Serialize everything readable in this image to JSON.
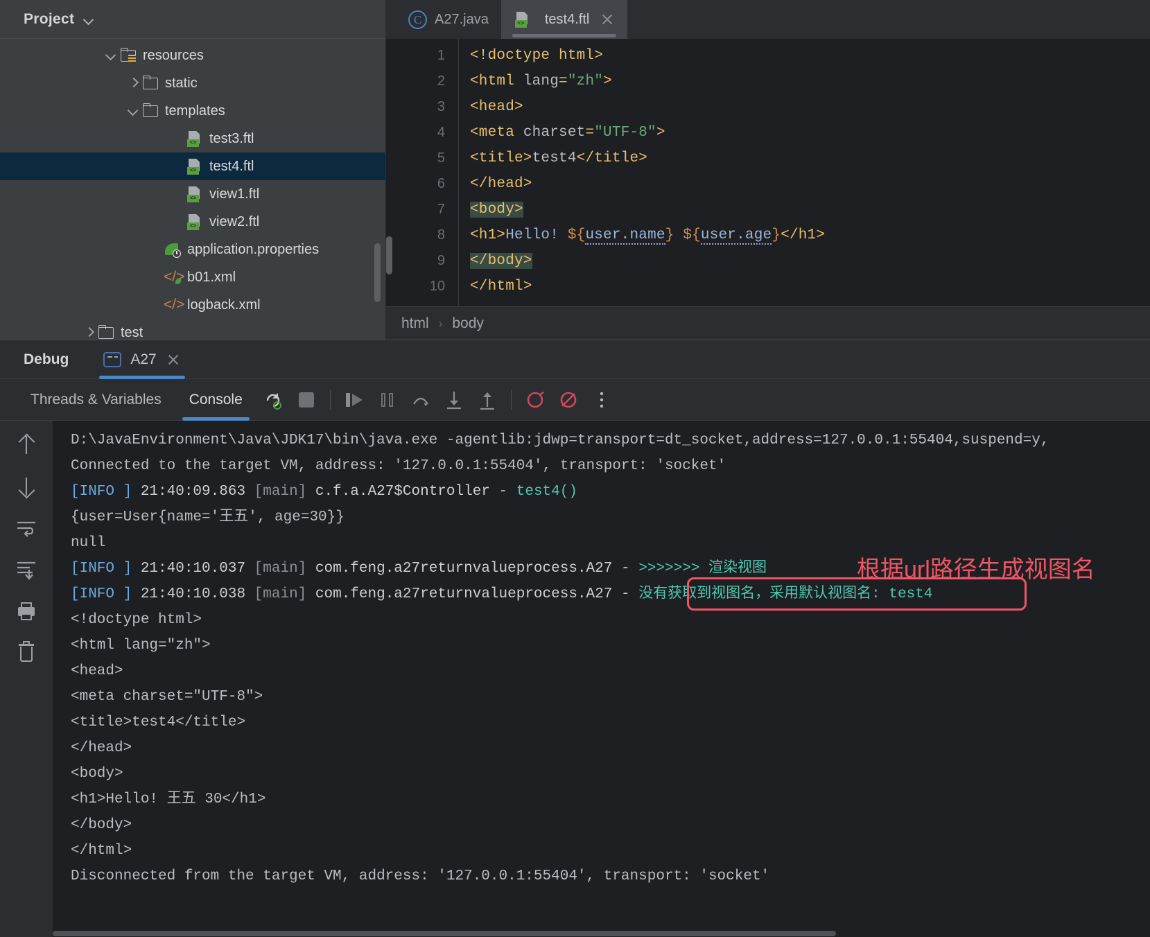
{
  "project": {
    "title": "Project",
    "toggle_icon": "chevron-down-icon",
    "tree": [
      {
        "label": "resources",
        "icon": "folder-resources-icon",
        "arrow": "down",
        "indent": 150,
        "selected": false
      },
      {
        "label": "static",
        "icon": "folder-icon",
        "arrow": "right",
        "indent": 182,
        "selected": false
      },
      {
        "label": "templates",
        "icon": "folder-icon",
        "arrow": "down",
        "indent": 182,
        "selected": false
      },
      {
        "label": "test3.ftl",
        "icon": "ftl-file-icon",
        "arrow": "none",
        "indent": 246,
        "selected": false
      },
      {
        "label": "test4.ftl",
        "icon": "ftl-file-icon",
        "arrow": "none",
        "indent": 246,
        "selected": true
      },
      {
        "label": "view1.ftl",
        "icon": "ftl-file-icon",
        "arrow": "none",
        "indent": 246,
        "selected": false
      },
      {
        "label": "view2.ftl",
        "icon": "ftl-file-icon",
        "arrow": "none",
        "indent": 246,
        "selected": false
      },
      {
        "label": "application.properties",
        "icon": "spring-properties-icon",
        "arrow": "none",
        "indent": 214,
        "selected": false
      },
      {
        "label": "b01.xml",
        "icon": "spring-xml-icon",
        "arrow": "none",
        "indent": 214,
        "selected": false
      },
      {
        "label": "logback.xml",
        "icon": "xml-icon",
        "arrow": "none",
        "indent": 214,
        "selected": false
      },
      {
        "label": "test",
        "icon": "folder-icon",
        "arrow": "right",
        "indent": 118,
        "selected": false
      }
    ]
  },
  "editor": {
    "tabs": [
      {
        "label": "A27.java",
        "icon": "java-class-icon",
        "active": false,
        "closable": false
      },
      {
        "label": "test4.ftl",
        "icon": "ftl-file-icon",
        "active": true,
        "closable": true
      }
    ],
    "line_numbers": [
      "1",
      "2",
      "3",
      "4",
      "5",
      "6",
      "7",
      "8",
      "9",
      "10"
    ],
    "code_lines": [
      "<!doctype html>",
      "<html lang=\"zh\">",
      "<head>",
      "    <meta charset=\"UTF-8\">",
      "    <title>test4</title>",
      "</head>",
      "<body>",
      "    <h1>Hello! ${user.name} ${user.age}</h1>",
      "</body>",
      "</html>"
    ],
    "breadcrumb": [
      "html",
      "body"
    ],
    "breadcrumb_separator": "›"
  },
  "debug": {
    "title": "Debug",
    "session_tab": "A27",
    "session_icon": "console-run-icon",
    "close_icon": "close-icon",
    "subtabs": [
      {
        "label": "Threads & Variables",
        "active": false
      },
      {
        "label": "Console",
        "active": true
      }
    ],
    "toolbar_icons": [
      "rerun-icon",
      "stop-icon",
      "resume-icon",
      "pause-icon",
      "step-over-icon",
      "step-into-icon",
      "step-out-icon",
      "view-breakpoints-icon",
      "mute-breakpoints-icon",
      "more-options-icon"
    ],
    "side_icons": [
      "scroll-up-icon",
      "scroll-down-icon",
      "soft-wrap-icon",
      "scroll-to-end-icon",
      "print-icon",
      "clear-all-icon"
    ],
    "console_lines": [
      {
        "type": "plain",
        "text": "D:\\JavaEnvironment\\Java\\JDK17\\bin\\java.exe -agentlib:jdwp=transport=dt_socket,address=127.0.0.1:55404,suspend=y,"
      },
      {
        "type": "plain",
        "text": "Connected to the target VM, address: '127.0.0.1:55404', transport: 'socket'"
      },
      {
        "type": "log",
        "level": "[INFO ]",
        "time": "21:40:09.863",
        "thread": "[main]",
        "logger": "c.f.a.A27$Controller",
        "dash": "-",
        "message": "test4()"
      },
      {
        "type": "plain",
        "text": "{user=User{name='王五', age=30}}"
      },
      {
        "type": "plain",
        "text": "null"
      },
      {
        "type": "log",
        "level": "[INFO ]",
        "time": "21:40:10.037",
        "thread": "[main]",
        "logger": "com.feng.a27returnvalueprocess.A27",
        "dash": "-",
        "message": ">>>>>>> 渲染视图"
      },
      {
        "type": "log",
        "level": "[INFO ]",
        "time": "21:40:10.038",
        "thread": "[main]",
        "logger": "com.feng.a27returnvalueprocess.A27",
        "dash": "-",
        "message": "没有获取到视图名，采用默认视图名: test4",
        "boxed": true
      },
      {
        "type": "plain",
        "text": "<!doctype html>"
      },
      {
        "type": "plain",
        "text": "<html lang=\"zh\">"
      },
      {
        "type": "plain",
        "text": "<head>"
      },
      {
        "type": "plain",
        "text": "    <meta charset=\"UTF-8\">"
      },
      {
        "type": "plain",
        "text": "    <title>test4</title>"
      },
      {
        "type": "plain",
        "text": "</head>"
      },
      {
        "type": "plain",
        "text": "<body>"
      },
      {
        "type": "plain",
        "text": "    <h1>Hello! 王五 30</h1>"
      },
      {
        "type": "plain",
        "text": "</body>"
      },
      {
        "type": "plain",
        "text": "</html>"
      },
      {
        "type": "plain",
        "text": "Disconnected from the target VM, address: '127.0.0.1:55404', transport: 'socket'"
      }
    ],
    "annotation": "根据url路径生成视图名"
  },
  "colors": {
    "accent_blue": "#4a88c7",
    "annotation_red": "#ef5564",
    "teal": "#4ec9b0",
    "info_blue": "#6aa9e0",
    "selection": "#0d293e"
  }
}
